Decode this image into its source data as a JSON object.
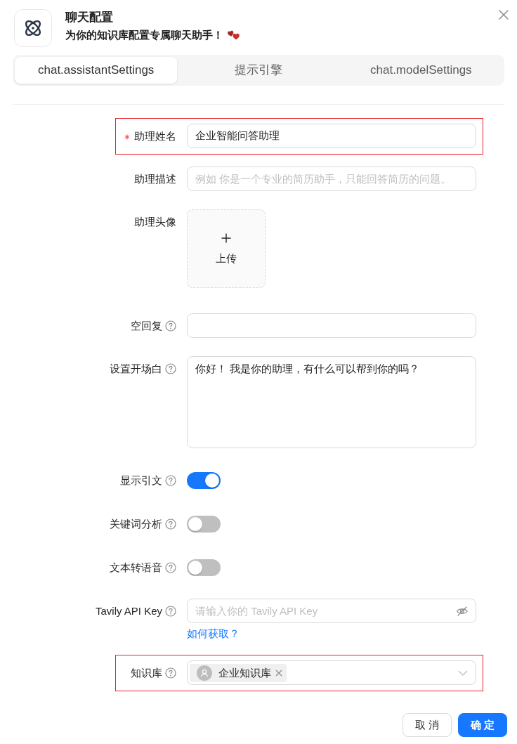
{
  "dialog": {
    "title": "聊天配置",
    "subtitle": "为你的知识库配置专属聊天助手！"
  },
  "tabs": [
    {
      "label": "chat.assistantSettings",
      "selected": true
    },
    {
      "label": "提示引擎",
      "selected": false
    },
    {
      "label": "chat.modelSettings",
      "selected": false
    }
  ],
  "form": {
    "fields": [
      {
        "kind": "text",
        "label": "助理姓名",
        "required": true,
        "help": false,
        "highlighted": true,
        "value": "企业智能问答助理"
      },
      {
        "kind": "text",
        "label": "助理描述",
        "required": false,
        "help": false,
        "highlighted": false,
        "placeholder": "例如 你是一个专业的简历助手，只能回答简历的问题。"
      },
      {
        "kind": "upload",
        "label": "助理头像",
        "required": false,
        "help": false,
        "highlighted": false,
        "button": "上传"
      },
      {
        "kind": "text",
        "label": "空回复",
        "required": false,
        "help": true,
        "highlighted": false
      },
      {
        "kind": "textarea",
        "label": "设置开场白",
        "required": false,
        "help": true,
        "highlighted": false,
        "value": "你好！ 我是你的助理，有什么可以帮到你的吗？"
      },
      {
        "kind": "switch",
        "label": "显示引文",
        "required": false,
        "help": true,
        "highlighted": false,
        "on": true
      },
      {
        "kind": "switch",
        "label": "关键词分析",
        "required": false,
        "help": true,
        "highlighted": false,
        "on": false
      },
      {
        "kind": "switch",
        "label": "文本转语音",
        "required": false,
        "help": true,
        "highlighted": false,
        "on": false
      },
      {
        "kind": "password",
        "label": "Tavily API Key",
        "required": false,
        "help": true,
        "highlighted": false,
        "placeholder": "请输入你的 Tavily API Key",
        "link": "如何获取？"
      },
      {
        "kind": "select",
        "label": "知识库",
        "required": false,
        "help": true,
        "highlighted": true,
        "tags": [
          "企业知识库"
        ]
      }
    ]
  },
  "buttons": [
    {
      "kind": "default",
      "label": "取 消"
    },
    {
      "kind": "primary",
      "label": "确 定"
    }
  ]
}
